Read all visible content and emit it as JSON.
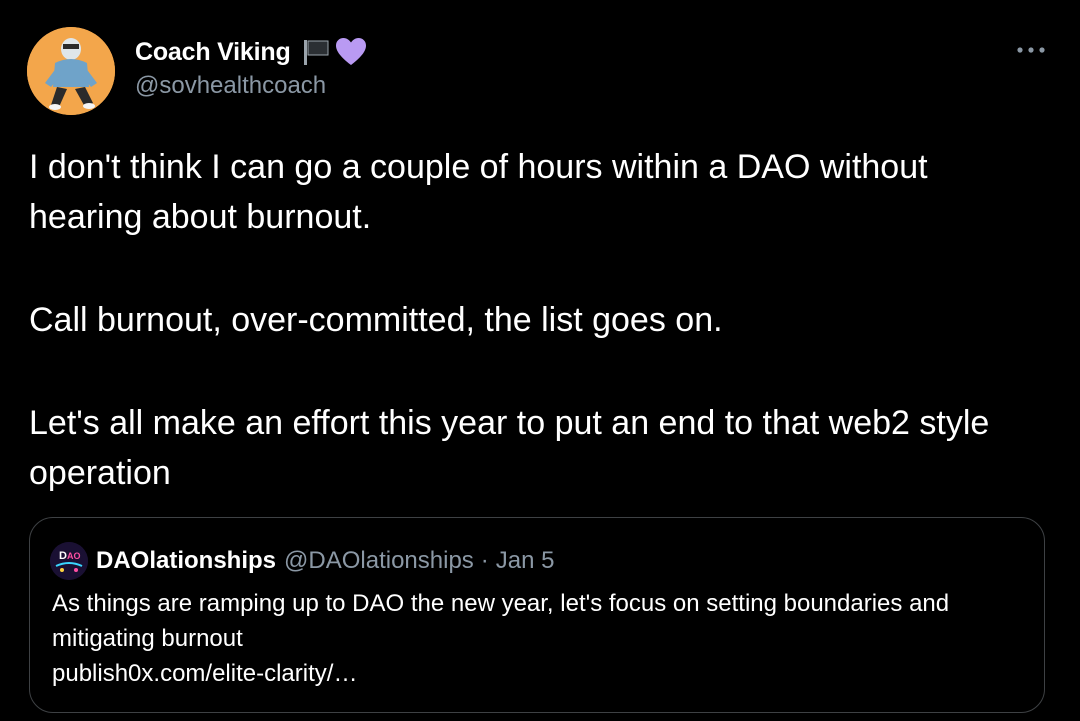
{
  "author": {
    "display_name": "Coach Viking",
    "handle": "@sovhealthcoach",
    "badges": [
      "flag-icon",
      "purple-heart-icon"
    ]
  },
  "tweet": {
    "paragraphs": [
      "I don't think I can go a couple of hours within a DAO without hearing about burnout.",
      "Call burnout, over-committed, the list goes on.",
      "Let's all make an effort this year to put an end to that web2 style operation"
    ]
  },
  "quoted_tweet": {
    "display_name": "DAOlationships",
    "handle": "@DAOlationships",
    "separator": "·",
    "date": "Jan 5",
    "text": "As things are ramping up to DAO the new year, let's focus on setting boundaries and mitigating burnout",
    "link": "publish0x.com/elite-clarity/…"
  },
  "icons": {
    "more": "more-options-icon"
  },
  "colors": {
    "background": "#000000",
    "text_primary": "#ffffff",
    "text_secondary": "#8b98a5",
    "border": "#3e4144",
    "heart": "#b99af3"
  }
}
